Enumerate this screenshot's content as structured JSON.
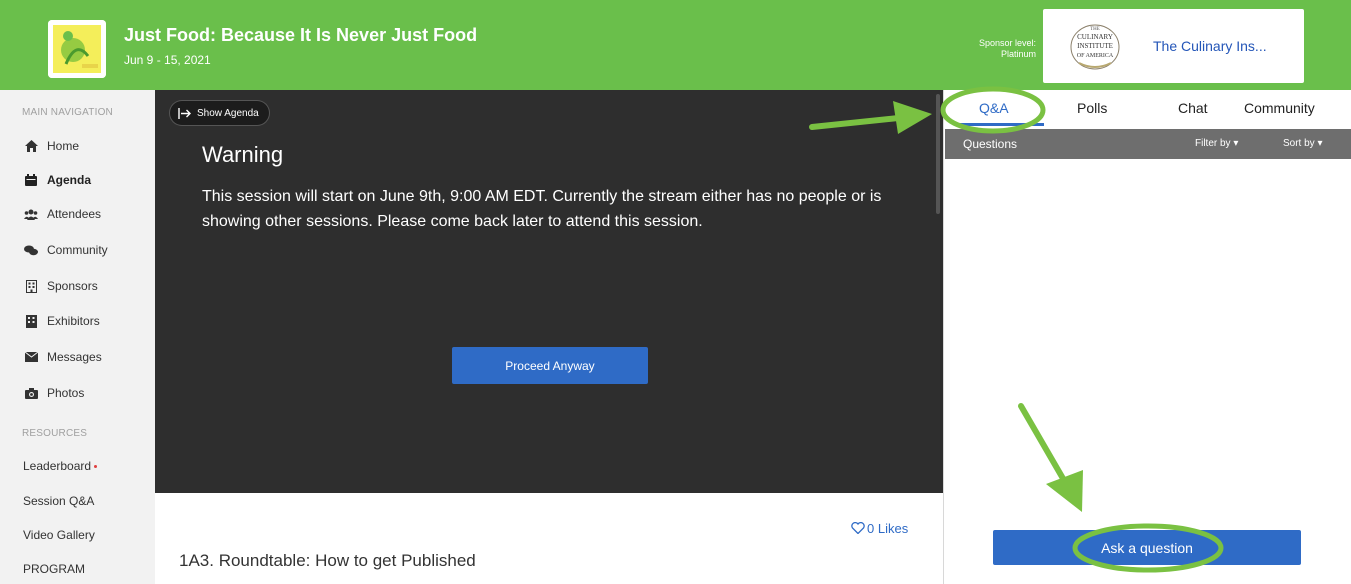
{
  "header": {
    "title": "Just Food: Because It Is Never Just Food",
    "dates": "Jun 9 - 15, 2021",
    "sponsor_level_label": "Sponsor level:",
    "sponsor_level_value": "Platinum",
    "sponsor_name": "The Culinary Ins...",
    "sponsor_logo_text": [
      "THE",
      "CULINARY",
      "INSTITUTE",
      "OF AMERICA"
    ]
  },
  "sidebar": {
    "main_nav_label": "MAIN NAVIGATION",
    "items": [
      {
        "label": "Home",
        "icon": "home-icon"
      },
      {
        "label": "Agenda",
        "icon": "calendar-icon",
        "active": true
      },
      {
        "label": "Attendees",
        "icon": "users-icon"
      },
      {
        "label": "Community",
        "icon": "comments-icon"
      },
      {
        "label": "Sponsors",
        "icon": "building-icon"
      },
      {
        "label": "Exhibitors",
        "icon": "exhibitor-icon"
      },
      {
        "label": "Messages",
        "icon": "envelope-icon"
      },
      {
        "label": "Photos",
        "icon": "camera-icon"
      }
    ],
    "resources_label": "RESOURCES",
    "resources": [
      {
        "label": "Leaderboard"
      },
      {
        "label": "Session Q&A"
      },
      {
        "label": "Video Gallery"
      },
      {
        "label": "PROGRAM"
      }
    ]
  },
  "video": {
    "show_agenda_label": "Show Agenda",
    "warning_title": "Warning",
    "warning_text": "This session will start on June 9th, 9:00 AM EDT. Currently the stream either has no people or is showing other sessions. Please come back later to attend this session.",
    "proceed_label": "Proceed Anyway"
  },
  "session": {
    "likes": "0 Likes",
    "title": "1A3. Roundtable: How to get Published"
  },
  "panel": {
    "tabs": [
      {
        "label": "Q&A",
        "active": true
      },
      {
        "label": "Polls"
      },
      {
        "label": "Chat"
      },
      {
        "label": "Community"
      }
    ],
    "questions_label": "Questions",
    "filter_label": "Filter by ▾",
    "sort_label": "Sort by ▾",
    "ask_label": "Ask a question"
  },
  "colors": {
    "header_green": "#6abf4b",
    "primary_blue": "#2f6bc6",
    "annotation_green": "#7ac142"
  }
}
